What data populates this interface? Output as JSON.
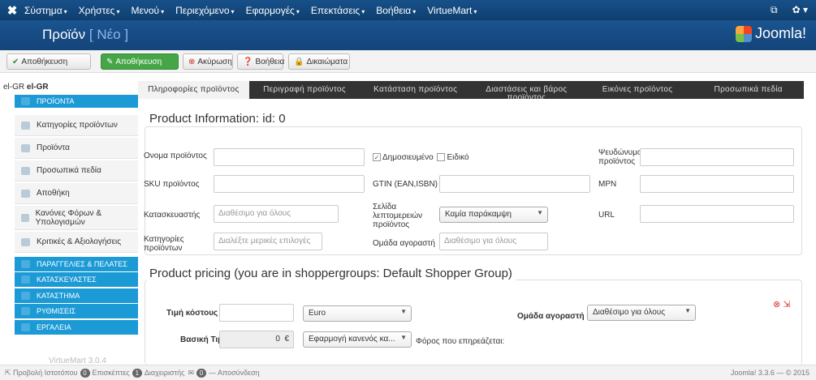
{
  "topbar": {
    "menus": [
      "Σύστημα",
      "Χρήστες",
      "Μενού",
      "Περιεχόμενο",
      "Εφαρμογές",
      "Επεκτάσεις",
      "Βοήθεια",
      "VirtueMart"
    ]
  },
  "header": {
    "title": "Προϊόν",
    "subtitle": "[ Νέο ]",
    "brand": "Joomla!"
  },
  "toolbar": {
    "save": "Αποθήκευση",
    "save_close": "Αποθήκευση",
    "cancel": "Ακύρωση",
    "help": "Βοήθεια",
    "permissions": "Δικαιώματα"
  },
  "sidebar": {
    "lang_prefix": "el-GR",
    "lang_bold": "el-GR",
    "items": [
      {
        "label": "ΠΡΟΪΟΝΤΑ",
        "style": "blue"
      },
      {
        "label": "Κατηγορίες προϊόντων",
        "style": "white"
      },
      {
        "label": "Προϊόντα",
        "style": "white"
      },
      {
        "label": "Προσωπικά πεδία",
        "style": "white"
      },
      {
        "label": "Αποθήκη",
        "style": "white"
      },
      {
        "label": "Κανόνες Φόρων & Υπολογισμών",
        "style": "white"
      },
      {
        "label": "Κριτικές & Αξιολογήσεις",
        "style": "white"
      },
      {
        "label": "ΠΑΡΑΓΓΕΛΙΕΣ & ΠΕΛΑΤΕΣ",
        "style": "blue"
      },
      {
        "label": "ΚΑΤΑΣΚΕΥΑΣΤΕΣ",
        "style": "blue"
      },
      {
        "label": "ΚΑΤΑΣΤΗΜΑ",
        "style": "blue"
      },
      {
        "label": "ΡΥΘΜΙΣΕΙΣ",
        "style": "blue"
      },
      {
        "label": "ΕΡΓΑΛΕΙΑ",
        "style": "blue"
      }
    ],
    "version": "VirtueMart 3.0.4"
  },
  "tabs": [
    "Πληροφορίες προϊόντος",
    "Περιγραφή προϊόντος",
    "Κατάσταση προϊόντος",
    "Διαστάσεις και βάρος προϊόντος",
    "Εικόνες προϊόντος",
    "Προσωπικά πεδία"
  ],
  "info": {
    "legend": "Product Information: id: 0",
    "name_label": "Ονομα προϊόντος",
    "published_label": "Δημοσιευμένο",
    "special_label": "Ειδικό",
    "alias_label": "Ψευδώνυμο προϊόντος",
    "sku_label": "SKU προϊόντος",
    "gtin_label": "GTIN (EAN,ISBN)",
    "mpn_label": "MPN",
    "manufacturer_label": "Κατασκευαστής",
    "manufacturer_placeholder": "Διαθέσιμο για όλους",
    "detail_page_label": "Σελίδα λεπτομερειών προϊόντος",
    "detail_page_value": "Καμία παράκαμψη",
    "url_label": "URL",
    "categories_label": "Κατηγορίες προϊόντων",
    "categories_placeholder": "Διαλέξτε μερικές επιλογές",
    "shopper_group_label": "Ομάδα αγοραστή",
    "shopper_group_placeholder": "Διαθέσιμο για όλους"
  },
  "pricing": {
    "legend": "Product pricing (you are in shoppergroups: Default Shopper Group)",
    "cost_label": "Τιμή κόστους",
    "currency": "Euro",
    "shopper_group_label": "Ομάδα αγοραστή",
    "shopper_group_value": "Διαθέσιμο για όλους",
    "base_price_label": "Βασική Τιμή",
    "base_price_value": "0",
    "euro_sign": "€",
    "tax_rule": "Εφαρμογή κανενός κα...",
    "tax_affects": "Φόρος που επηρεάζεται:"
  },
  "status": {
    "view_site": "Προβολή Ιστοτόπου",
    "visitors_count": "0",
    "visitors": "Επισκέπτες",
    "admins_count": "1",
    "admins": "Διαχειριστής",
    "messages_count": "0",
    "logout": "Αποσύνδεση",
    "version": "Joomla! 3.3.6 — © 2015"
  }
}
